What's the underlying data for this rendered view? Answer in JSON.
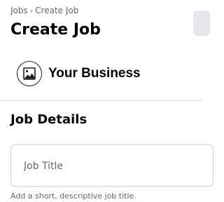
{
  "breadcrumb": {
    "parent": "Jobs",
    "separator": "›",
    "current": "Create Job"
  },
  "page_title": "Create Job",
  "business": {
    "name": "Your Business",
    "avatar_icon": "image-placeholder-icon"
  },
  "job_details": {
    "section_title": "Job Details",
    "job_title": {
      "value": "",
      "placeholder": "Job Title",
      "helper": "Add a short, descriptive job title."
    }
  },
  "colors": {
    "text_primary": "#050505",
    "text_secondary": "#65676b",
    "divider": "#ced0d4",
    "input_border": "#ccd0d5",
    "button_bg": "#e4e6eb"
  }
}
